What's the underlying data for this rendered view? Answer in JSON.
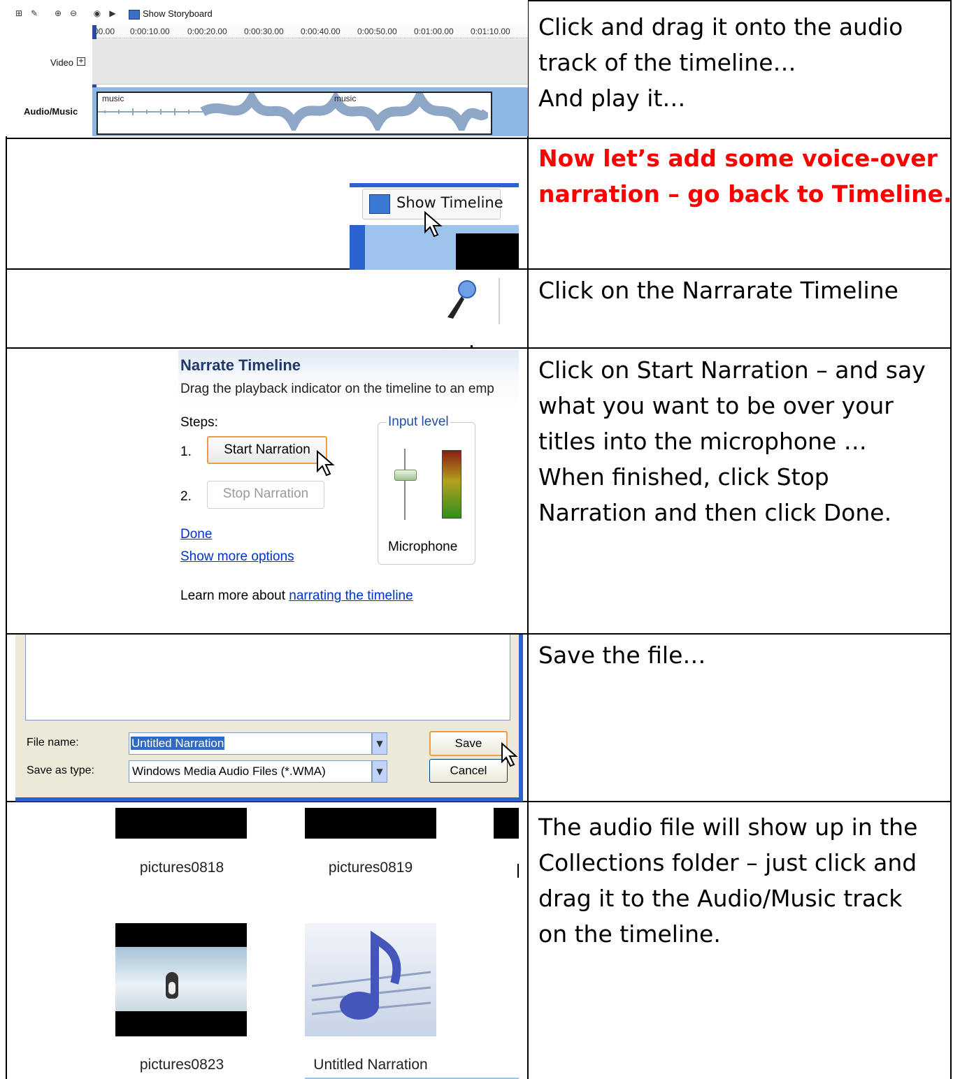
{
  "rows": [
    {
      "instruction_lines": [
        "Click and drag it onto the audio",
        "track of the timeline…",
        "And play it…"
      ],
      "screenshot": {
        "toolbar_button": "Show Storyboard",
        "ruler_ticks": [
          "00.00",
          "0:00:10.00",
          "0:00:20.00",
          "0:00:30.00",
          "0:00:40.00",
          "0:00:50.00",
          "0:01:00.00",
          "0:01:10.00"
        ],
        "video_track_label": "Video",
        "audio_track_label": "Audio/Music",
        "clip_labels": [
          "music",
          "music"
        ]
      }
    },
    {
      "instruction_lines": [
        "Now let’s add some voice-over",
        "narration – go back to Timeline."
      ],
      "instruction_color": "#ff0000",
      "screenshot": {
        "button": "Show Timeline"
      }
    },
    {
      "instruction_lines": [
        "Click on the Narrarate Timeline"
      ],
      "screenshot": {
        "icon": "microphone-icon"
      }
    },
    {
      "instruction_lines": [
        "Click on Start Narration – and say",
        "what you want to be over your",
        "titles into the microphone  …",
        "When finished, click Stop",
        "Narration and then click Done."
      ],
      "screenshot": {
        "title": "Narrate Timeline",
        "subtitle": "Drag the playback indicator on the timeline to an emp",
        "steps_label": "Steps:",
        "step1_num": "1.",
        "step1_button": "Start Narration",
        "step2_num": "2.",
        "step2_button": "Stop Narration",
        "done_link": "Done",
        "more_link": "Show more options",
        "input_level_label": "Input level",
        "device_label": "Microphone",
        "learn_prefix": "Learn more about ",
        "learn_link": "narrating the timeline"
      }
    },
    {
      "instruction_lines": [
        "Save the file…"
      ],
      "screenshot": {
        "filename_label": "File name:",
        "filename_value": "Untitled Narration",
        "savetype_label": "Save as type:",
        "savetype_value": "Windows Media Audio Files (*.WMA)",
        "save_button": "Save",
        "cancel_button": "Cancel"
      }
    },
    {
      "instruction_lines": [
        "The audio file will show up in the",
        "Collections folder – just click and",
        "drag it to the Audio/Music track",
        "on the timeline."
      ],
      "screenshot": {
        "items": [
          "pictures0818",
          "pictures0819",
          "pictures0823",
          "Untitled Narration"
        ]
      }
    }
  ]
}
